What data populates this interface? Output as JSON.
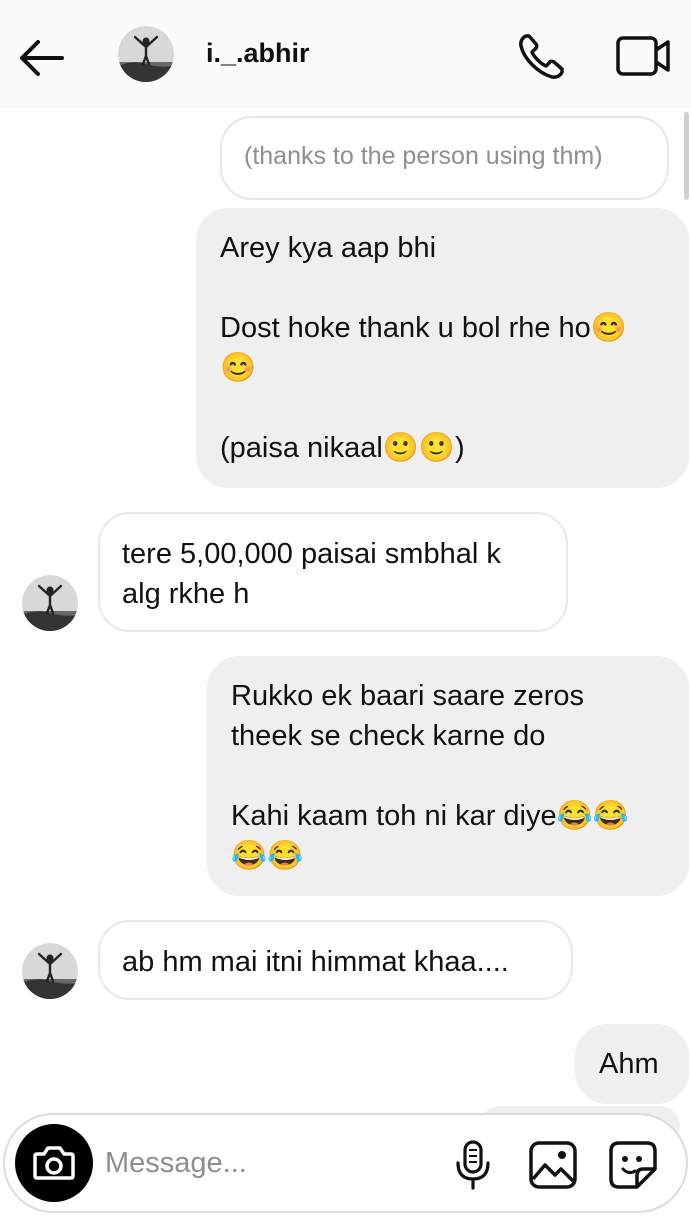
{
  "header": {
    "username": "i._.abhir",
    "icons": {
      "back": "arrow-left-icon",
      "call": "phone-icon",
      "video": "video-camera-icon"
    }
  },
  "messages": [
    {
      "type": "note",
      "text": "(thanks to the person using thm)"
    },
    {
      "type": "sent",
      "text": "Arey kya aap bhi\n\nDost hoke thank u bol rhe ho😊\n😊\n\n(paisa nikaal🙂🙂)"
    },
    {
      "type": "received",
      "text": "tere 5,00,000 paisai smbhal k\nalg rkhe h"
    },
    {
      "type": "sent",
      "text": "Rukko ek baari saare zeros\ntheek se check karne do\n\nKahi kaam toh ni kar diye😂😂\n😂😂"
    },
    {
      "type": "received",
      "text": "ab hm mai itni himmat khaa...."
    },
    {
      "type": "sent",
      "text": "Ahm"
    }
  ],
  "composer": {
    "placeholder": "Message...",
    "icons": {
      "camera": "camera-icon",
      "mic": "microphone-icon",
      "gallery": "image-icon",
      "sticker": "sticker-icon"
    }
  },
  "colors": {
    "sent_bubble": "#efefef",
    "border": "#dbdbdb",
    "muted_text": "#8e8e8e"
  }
}
